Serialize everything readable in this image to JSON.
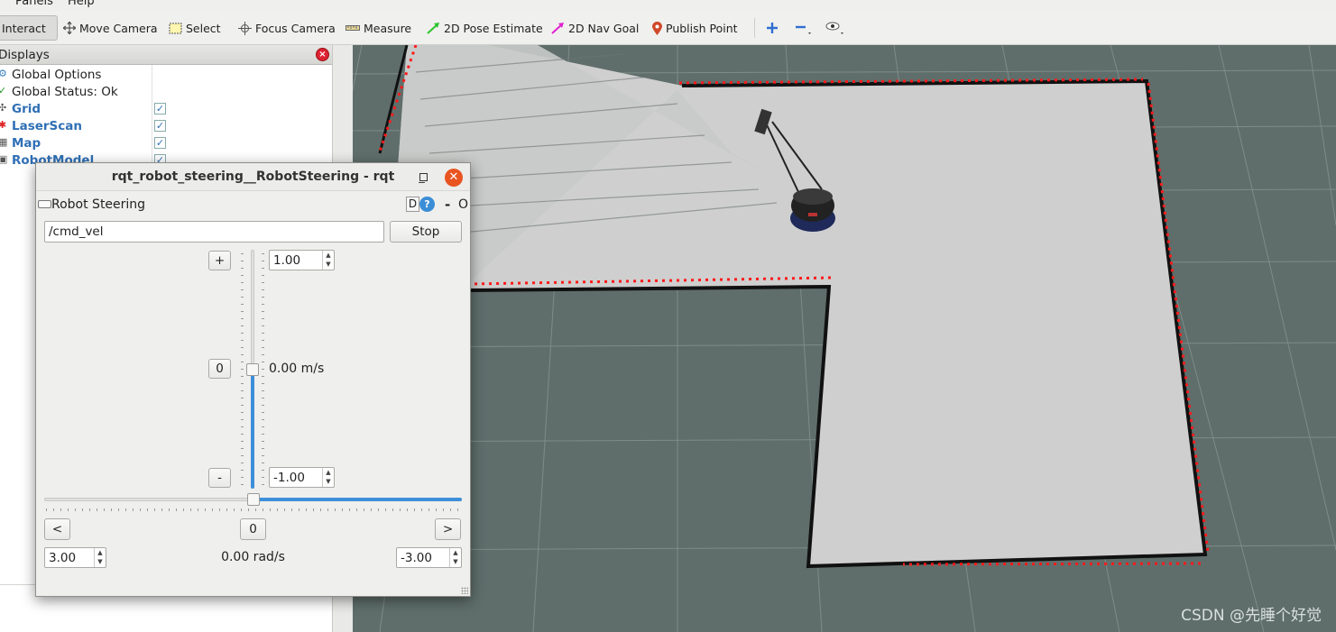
{
  "menu": {
    "panels": "Panels",
    "help": "Help"
  },
  "toolbar": {
    "interact": "Interact",
    "move_camera": "Move Camera",
    "select": "Select",
    "focus_camera": "Focus Camera",
    "measure": "Measure",
    "pose_estimate": "2D Pose Estimate",
    "nav_goal": "2D Nav Goal",
    "publish_point": "Publish Point",
    "icons": [
      "interact-icon",
      "move-camera-icon",
      "select-icon",
      "focus-camera-icon",
      "ruler-icon",
      "green-arrow-icon",
      "magenta-arrow-icon",
      "map-pin-icon",
      "plus-icon",
      "minus-icon",
      "eye-icon"
    ]
  },
  "displays": {
    "title": "Displays",
    "items": [
      {
        "label": "Global Options",
        "checkable": false
      },
      {
        "label": "Global Status: Ok",
        "checkable": false
      },
      {
        "label": "Grid",
        "checkable": true,
        "checked": true
      },
      {
        "label": "LaserScan",
        "checkable": true,
        "checked": true
      },
      {
        "label": "Map",
        "checkable": true,
        "checked": true
      },
      {
        "label": "RobotModel",
        "checkable": true,
        "checked": true
      }
    ]
  },
  "rqt": {
    "window_title": "rqt_robot_steering__RobotSteering - rqt",
    "plugin_title": "Robot Steering",
    "d_button": "D",
    "help_button": "?",
    "minimize_plugin": "-",
    "close_plugin": "O",
    "topic": "/cmd_vel",
    "stop": "Stop",
    "linear": {
      "plus": "+",
      "zero": "0",
      "minus": "-",
      "max": "1.00",
      "min": "-1.00",
      "value": "0.00 m/s",
      "fraction": 0.5
    },
    "angular": {
      "left": "<",
      "zero": "0",
      "right": ">",
      "max": "3.00",
      "min": "-3.00",
      "value": "0.00 rad/s",
      "fraction": 0.5
    }
  },
  "viewport": {
    "watermark": "CSDN @先睡个好觉",
    "colors": {
      "background": "#5f6e6b",
      "map_free": "#cfcfcf",
      "laser": "#ff1a1a",
      "walls": "#111111"
    }
  }
}
